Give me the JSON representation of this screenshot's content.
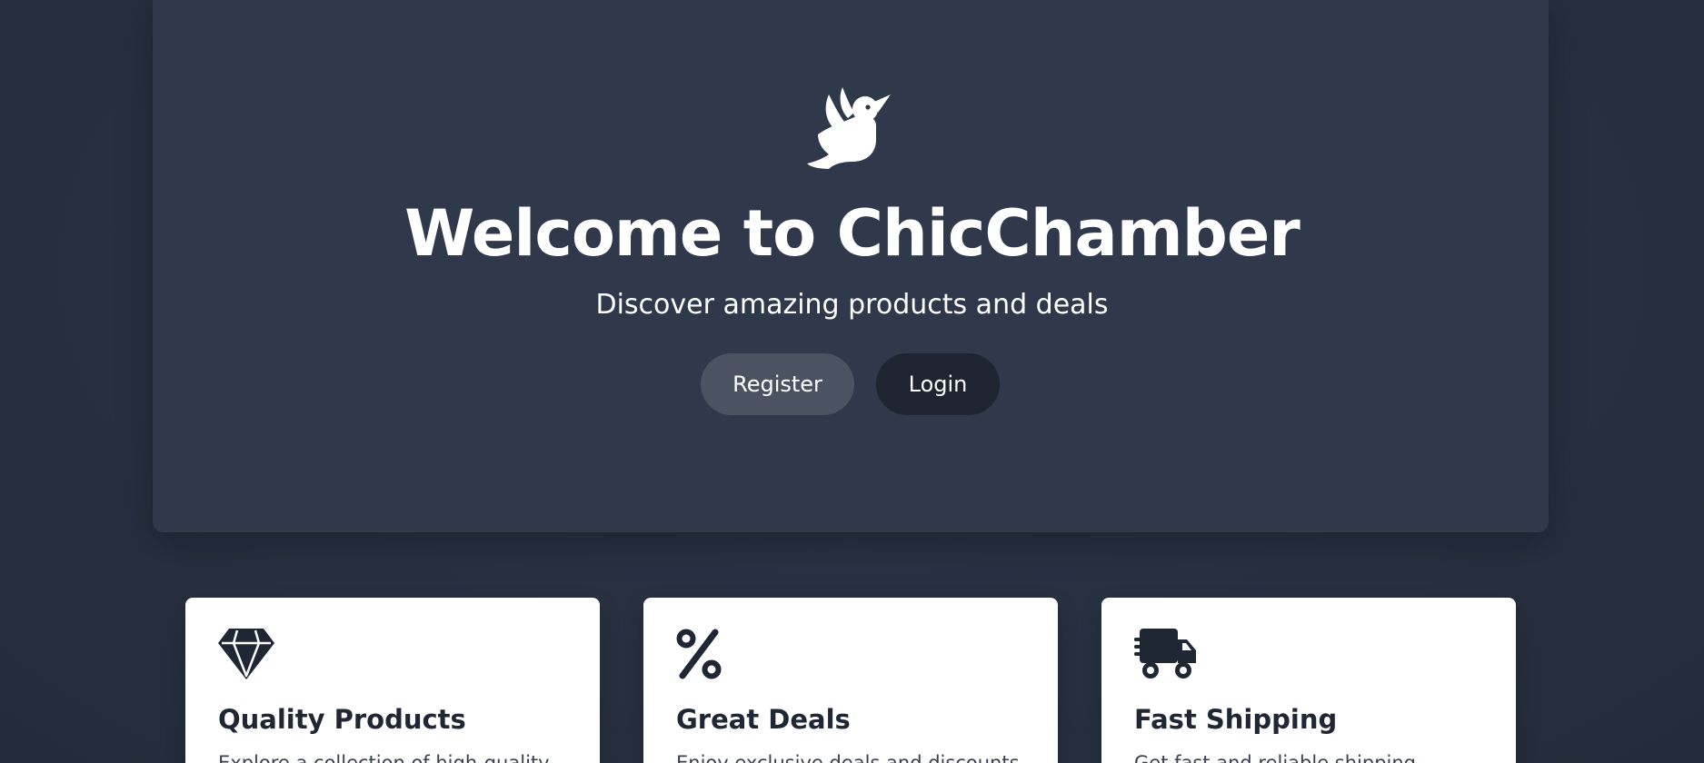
{
  "hero": {
    "logo_icon": "dove-icon",
    "title": "Welcome to ChicChamber",
    "subtitle": "Discover amazing products and deals",
    "buttons": {
      "register_label": "Register",
      "login_label": "Login"
    }
  },
  "features": [
    {
      "icon": "gem-icon",
      "title": "Quality Products",
      "description": "Explore a collection of high-quality"
    },
    {
      "icon": "percent-icon",
      "title": "Great Deals",
      "description": "Enjoy exclusive deals and discounts"
    },
    {
      "icon": "shipping-fast-icon",
      "title": "Fast Shipping",
      "description": "Get fast and reliable shipping"
    }
  ],
  "colors": {
    "background": "#273041",
    "hero_panel": "#2f394b",
    "register_button": "#4b5363",
    "login_button": "#1e2432",
    "card_background": "#ffffff",
    "card_text": "#1f2634"
  }
}
